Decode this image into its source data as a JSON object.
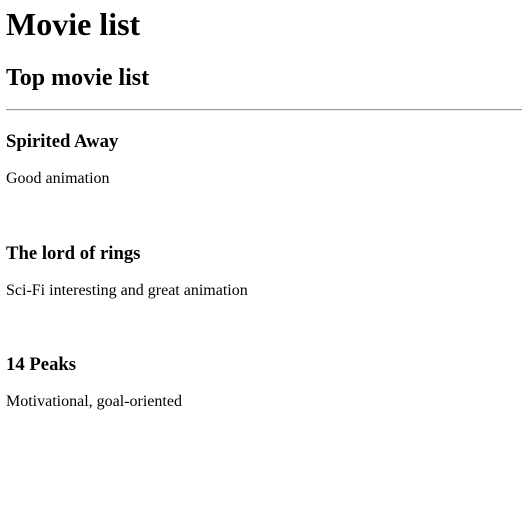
{
  "page": {
    "title": "Movie list",
    "subtitle": "Top movie list"
  },
  "movies": [
    {
      "title": "Spirited Away",
      "description": "Good animation"
    },
    {
      "title": "The lord of rings",
      "description": "Sci-Fi interesting and great animation"
    },
    {
      "title": "14 Peaks",
      "description": "Motivational, goal-oriented"
    }
  ]
}
